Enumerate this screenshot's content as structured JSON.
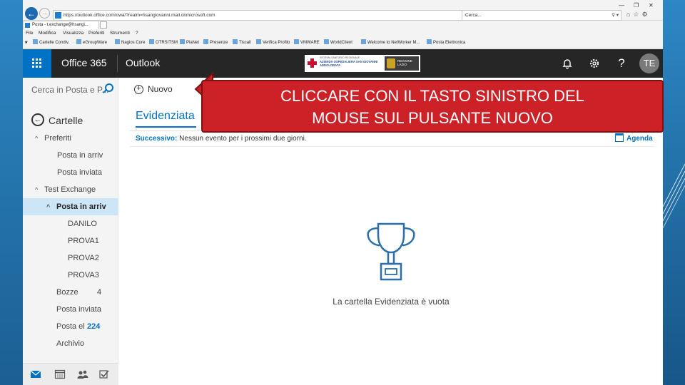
{
  "browser": {
    "url": "https://outlook.office.com/owa/?realm=hsangiovanni.mail.onmicrosoft.com",
    "search_placeholder": "Cerca...",
    "tab_title": "Posta - t.exchange@hsangi...",
    "menu": [
      "File",
      "Modifica",
      "Visualizza",
      "Preferiti",
      "Strumenti",
      "?"
    ],
    "favorites": [
      "Cartelle Condiv.",
      "eGroupWare",
      "Nagios Core",
      "OTRSITSM",
      "PlaNet",
      "Presenze",
      "Tiscali",
      "Verifica Profilo",
      "VMWARE",
      "WorldClient",
      "Welcome to NetWorker M...",
      "Posta Elettronica"
    ]
  },
  "header": {
    "suite": "Office 365",
    "app": "Outlook",
    "logo_line1": "SISTEMA SANITARIO REGIONALE",
    "logo_line2": "AZIENDA OSPEDALIERA SAN GIOVANNI ADDOLORATA",
    "logo_region": "REGIONE LAZIO",
    "help": "?",
    "avatar": "TE",
    "icons": [
      "bell-icon",
      "gear-icon",
      "help-icon"
    ]
  },
  "leftpane": {
    "search_placeholder": "Cerca in Posta e P...",
    "folders_title": "Cartelle",
    "items": [
      {
        "label": "Preferiti",
        "chev": "^",
        "count": ""
      },
      {
        "label": "Posta in arriv",
        "chev": "",
        "count": ""
      },
      {
        "label": "Posta inviata",
        "chev": "",
        "count": ""
      },
      {
        "label": "Test Exchange",
        "chev": "^",
        "count": ""
      },
      {
        "label": "Posta in arriv",
        "chev": "^",
        "count": ""
      },
      {
        "label": "DANILO",
        "chev": "",
        "count": ""
      },
      {
        "label": "PROVA1",
        "chev": "",
        "count": ""
      },
      {
        "label": "PROVA2",
        "chev": "",
        "count": ""
      },
      {
        "label": "PROVA3",
        "chev": "",
        "count": ""
      },
      {
        "label": "Bozze",
        "chev": "",
        "count": "4"
      },
      {
        "label": "Posta inviata",
        "chev": "",
        "count": ""
      },
      {
        "label": "Posta el",
        "chev": "",
        "count": "224"
      },
      {
        "label": "Archivio",
        "chev": "",
        "count": ""
      }
    ]
  },
  "main": {
    "new_button": "Nuovo",
    "view_title": "Evidenziata",
    "next_label": "Successivo:",
    "next_text": "Nessun evento per i prossimi due giorni.",
    "agenda": "Agenda",
    "empty_text": "La cartella Evidenziata è vuota"
  },
  "callout": {
    "line1": "CLICCARE CON IL TASTO SINISTRO DEL",
    "line2": "MOUSE SUL PULSANTE NUOVO"
  },
  "colors": {
    "accent": "#0072c6",
    "header_bg": "#262626",
    "callout_bg": "#cc2127",
    "selected_bg": "#cde6f7"
  }
}
